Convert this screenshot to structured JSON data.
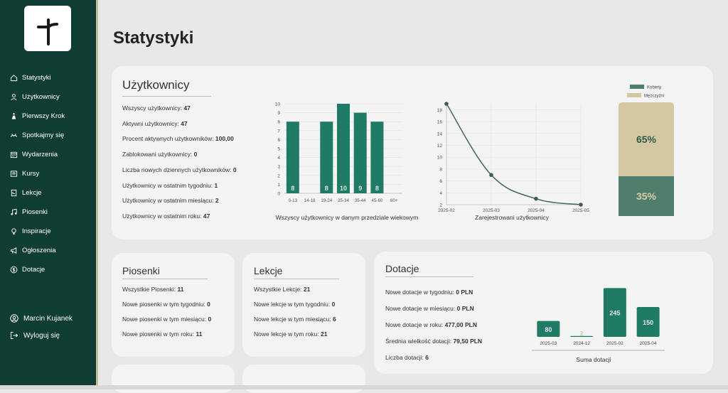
{
  "page": {
    "title": "Statystyki"
  },
  "colors": {
    "sidebar": "#0f3d33",
    "accent": "#1f7a66",
    "women": "#4f7e6c",
    "men": "#d4c8a3"
  },
  "sidebar": {
    "items": [
      {
        "label": "Statystyki",
        "icon": "home-icon"
      },
      {
        "label": "Użytkownicy",
        "icon": "user-icon"
      },
      {
        "label": "Pierwszy Krok",
        "icon": "steps-icon"
      },
      {
        "label": "Spotkajmy się",
        "icon": "meet-icon"
      },
      {
        "label": "Wydarzenia",
        "icon": "calendar-icon"
      },
      {
        "label": "Kursy",
        "icon": "courses-icon"
      },
      {
        "label": "Lekcje",
        "icon": "lesson-icon"
      },
      {
        "label": "Piosenki",
        "icon": "music-icon"
      },
      {
        "label": "Inspiracje",
        "icon": "bulb-icon"
      },
      {
        "label": "Ogłoszenia",
        "icon": "megaphone-icon"
      },
      {
        "label": "Dotacje",
        "icon": "dollar-icon"
      }
    ],
    "user_name": "Marcin Kujanek",
    "logout_label": "Wyloguj się"
  },
  "users": {
    "title": "Użytkownicy",
    "stats": [
      {
        "label": "Wszyscy użytkownicy: ",
        "value": "47"
      },
      {
        "label": "Aktywni użytkownicy: ",
        "value": "47"
      },
      {
        "label": "Procent aktywnych użytkowników: ",
        "value": "100,00"
      },
      {
        "label": "Zablokowani użytkownicy: ",
        "value": "0"
      },
      {
        "label": "Liczba nowych dziennych użytkowników: ",
        "value": "0"
      },
      {
        "label": "Użytkownicy w ostatnim tygodniu: ",
        "value": "1"
      },
      {
        "label": "Użytkownicy w ostatnim miesiącu: ",
        "value": "2"
      },
      {
        "label": "Użytkownicy w ostatnim roku: ",
        "value": "47"
      }
    ]
  },
  "songs": {
    "title": "Piosenki",
    "stats": [
      {
        "label": "Wszystkie Piosenki: ",
        "value": "11"
      },
      {
        "label": "Nowe piosenki w tym tygodniu: ",
        "value": "0"
      },
      {
        "label": "Nowe piosenki w tym miesiącu: ",
        "value": "0"
      },
      {
        "label": "Nowe piosenki w tym roku: ",
        "value": "11"
      }
    ]
  },
  "lessons": {
    "title": "Lekcje",
    "stats": [
      {
        "label": "Wszystkie Lekcje: ",
        "value": "21"
      },
      {
        "label": "Nowe lekcje w tym tygodniu: ",
        "value": "0"
      },
      {
        "label": "Nowe lekcje w tym miesiącu: ",
        "value": "6"
      },
      {
        "label": "Nowe lekcje w tym roku: ",
        "value": "21"
      }
    ]
  },
  "donations": {
    "title": "Dotacje",
    "stats": [
      {
        "label": "Nowe dotacje w tygodniu: ",
        "value": "0 PLN"
      },
      {
        "label": "Nowe dotacje w miesiącu: ",
        "value": "0 PLN"
      },
      {
        "label": "Nowe dotacje w roku: ",
        "value": "477,00 PLN"
      },
      {
        "label": "Średnia wielkość dotacji: ",
        "value": "79,50 PLN"
      },
      {
        "label": "Liczba dotacji: ",
        "value": "6"
      }
    ]
  },
  "chart_data": [
    {
      "id": "age",
      "type": "bar",
      "categories": [
        "0-13",
        "14-18",
        "19-24",
        "25-34",
        "35-44",
        "45-60",
        "60+"
      ],
      "values": [
        8,
        0,
        8,
        10,
        9,
        8,
        0
      ],
      "ylim": [
        0,
        10
      ],
      "yticks": [
        0,
        1,
        2,
        3,
        4,
        5,
        6,
        7,
        8,
        9,
        10
      ],
      "xlabel": "Wszyscy użytkownicy w danym przedziale wiekowym",
      "grid": "horizontal"
    },
    {
      "id": "registered",
      "type": "line",
      "x": [
        "2025-02",
        "2025-03",
        "2025-04",
        "2025-05"
      ],
      "values": [
        19,
        7,
        3,
        2
      ],
      "ylim": [
        2,
        19
      ],
      "yticks": [
        2,
        4,
        6,
        8,
        10,
        12,
        14,
        16,
        18
      ],
      "xlabel": "Zarejestrowani użytkownicy",
      "grid": "both"
    },
    {
      "id": "gender",
      "type": "bar",
      "stacked": true,
      "series": [
        {
          "name": "Kobiety",
          "values": [
            35
          ],
          "label": "35%"
        },
        {
          "name": "Mężczyźni",
          "values": [
            65
          ],
          "label": "65%"
        }
      ],
      "ylim": [
        0,
        100
      ],
      "legend": "top"
    },
    {
      "id": "donations",
      "type": "bar",
      "categories": [
        "2025-03",
        "2024-12",
        "2025-02",
        "2025-04"
      ],
      "values": [
        80,
        2,
        245,
        150
      ],
      "ylim": [
        0,
        250
      ],
      "xlabel": "Suma dotacji",
      "grid": "none"
    }
  ]
}
